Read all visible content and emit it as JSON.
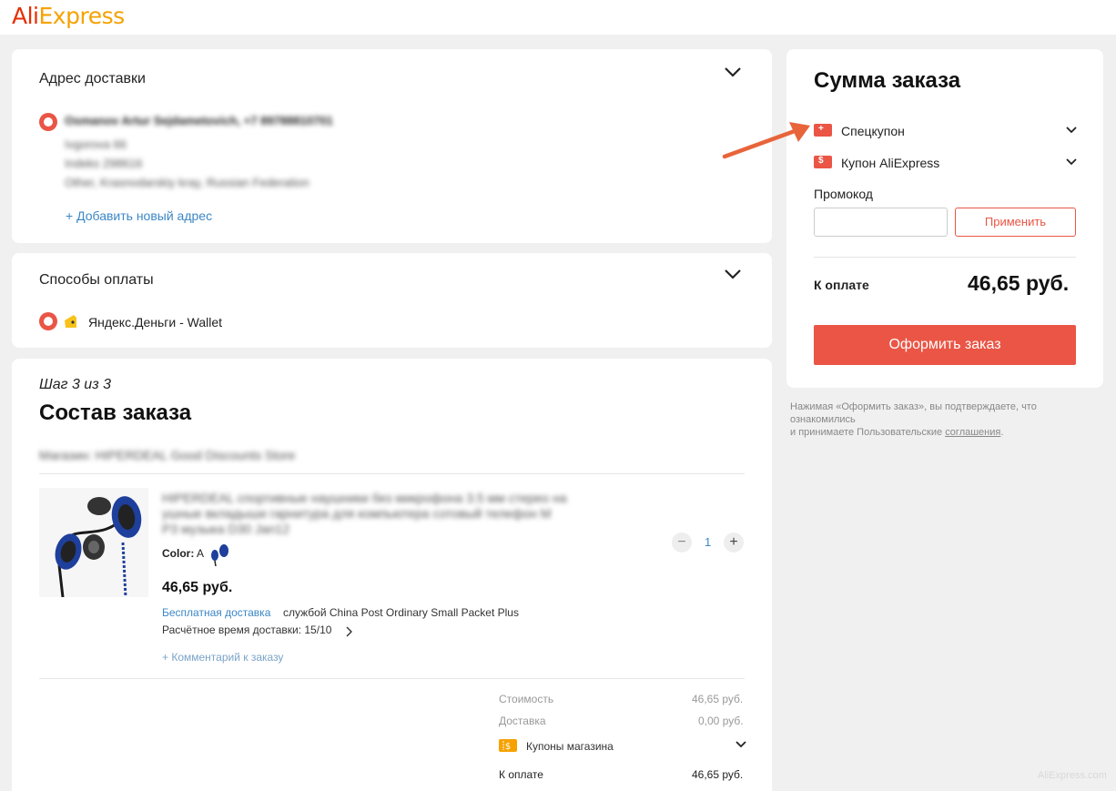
{
  "header": {
    "logo_ali": "Ali",
    "logo_express": "Express"
  },
  "address": {
    "title": "Адрес доставки",
    "name_line": "Osmanov Artur Sejdametovich, +7 89788810701",
    "line1": "Ivgorova 66",
    "line2": "Indeks 298616",
    "line3": "Other, Krasnodarskiy kray, Russian Federation",
    "add_link": "+ Добавить новый адрес"
  },
  "payment": {
    "title": "Способы оплаты",
    "method": "Яндекс.Деньги - Wallet"
  },
  "order": {
    "step": "Шаг 3 из 3",
    "title": "Состав заказа",
    "store": "Магазин: HIPERDEAL Good Discounts Store",
    "product_title_1": "HIPERDEAL спортивные наушники без микрофона 3.5 мм стерео на",
    "product_title_2": "ушные вкладыши гарнитура для компьютера сотовый телефон M",
    "product_title_3": "P3 музыка D30 Jan12",
    "color_label": "Color:",
    "color_value": "A",
    "price": "46,65 руб.",
    "free_shipping": "Бесплатная доставка",
    "shipping_service": "службой China Post Ordinary Small Packet Plus",
    "delivery_time": "Расчётное время доставки: 15/10",
    "qty": "1",
    "comment_link": "+ Комментарий к заказу",
    "cost_label": "Стоимость",
    "cost_value": "46,65 руб.",
    "delivery_label": "Доставка",
    "delivery_value": "0,00 руб.",
    "store_coupons": "Купоны магазина",
    "to_pay_label": "К оплате",
    "to_pay_value": "46,65 руб."
  },
  "summary": {
    "title": "Сумма заказа",
    "special_coupon": "Спецкупон",
    "ali_coupon": "Купон AliExpress",
    "promo_label": "Промокод",
    "promo_value": "",
    "apply": "Применить",
    "to_pay_label": "К оплате",
    "total": "46,65 руб.",
    "submit": "Оформить заказ",
    "disclaimer_1": "Нажимая «Оформить заказ», вы подтверждаете, что ознакомились",
    "disclaimer_2": "и принимаете Пользовательские ",
    "disclaimer_link": "соглашения",
    "disclaimer_end": "."
  },
  "watermark": "AliExpress.com",
  "colors": {
    "accent": "#ea5545",
    "link": "#3b87c6",
    "background": "#f0f0f0"
  }
}
